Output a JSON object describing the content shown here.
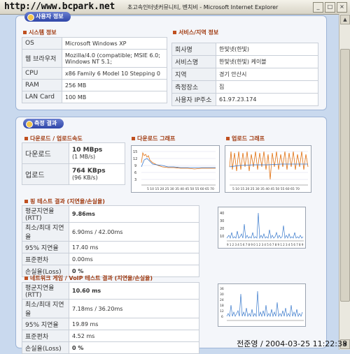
{
  "browser": {
    "address_overlay": "http://www.bcpark.net",
    "title": "초고속인터넷커뮤니티, 벤치비 - Microsoft Internet Explorer"
  },
  "system_panel": {
    "header": "사용자 정보",
    "system_section": "시스템 정보",
    "system_rows": [
      {
        "k": "OS",
        "v": "Microsoft Windows XP"
      },
      {
        "k": "웹 브라우저",
        "v": "Mozilla/4.0 (compatible; MSIE 6.0; Windows NT 5.1;"
      },
      {
        "k": "CPU",
        "v": "x86 Family 6 Model 10 Stepping 0"
      },
      {
        "k": "RAM",
        "v": "256 MB"
      },
      {
        "k": "LAN Card",
        "v": "100 MB"
      }
    ],
    "service_section": "서비스/지역 정보",
    "service_rows": [
      {
        "k": "회사명",
        "v": "한빛넷(한빛)"
      },
      {
        "k": "서비스명",
        "v": "한빛넷(한빛) 케이블"
      },
      {
        "k": "지역",
        "v": "경기 안산시"
      },
      {
        "k": "측정장소",
        "v": "집"
      },
      {
        "k": "사용자 IP주소",
        "v": "61.97.23.174"
      }
    ]
  },
  "results_panel": {
    "header": "측정 결과",
    "speed_section": "다운로드 / 업로드속도",
    "download_label": "다운로드",
    "download_main": "10 MBps",
    "download_sub": "(1 MB/s)",
    "upload_label": "업로드",
    "upload_main": "764 KBps",
    "upload_sub": "(96 KB/s)",
    "dl_graph_title": "다운로드 그래프",
    "ul_graph_title": "업로드 그래프",
    "dl_graph_y": [
      "15",
      "12",
      "9",
      "6",
      "3"
    ],
    "dl_graph_x": [
      "5",
      "10",
      "15",
      "20",
      "25",
      "30",
      "35",
      "40",
      "45",
      "50",
      "55",
      "60",
      "65",
      "70"
    ],
    "ping_section": "핑 테스트 결과 (지연율/손실율)",
    "ping_rows": [
      {
        "k": "평균지연율(RTT)",
        "v": "9.86ms",
        "bold": true
      },
      {
        "k": "최소/최대 지연율",
        "v": "6.90ms / 42.00ms"
      },
      {
        "k": "95% 지연율",
        "v": "17.40 ms"
      },
      {
        "k": "표준편차",
        "v": "0.00ms"
      },
      {
        "k": "손실율(Loss)",
        "v": "0 %",
        "bold": true
      }
    ],
    "ping_graph_y": [
      "40",
      "30",
      "20",
      "10"
    ],
    "ping_graph_x": "9 1 2 3 4 5 6 7 8 9 0 1 2 3 4 5 6 7 8 9 1 2 3 4 5 6 7 8 9",
    "game_section": "네트워크 게임 / VoIP 테스트 결과 (지연율/손실율)",
    "game_rows": [
      {
        "k": "평균지연율(RTT)",
        "v": "10.60 ms",
        "bold": true
      },
      {
        "k": "최소/최대 지연율",
        "v": "7.18ms / 36.20ms"
      },
      {
        "k": "95% 지연율",
        "v": "19.89 ms"
      },
      {
        "k": "표준편차",
        "v": "4.52 ms"
      },
      {
        "k": "손실율(Loss)",
        "v": "0 %",
        "bold": true
      }
    ],
    "game_graph_y": [
      "36",
      "30",
      "24",
      "18",
      "12",
      "6"
    ]
  },
  "footer": "전준영 / 2004-03-25 11:22:38",
  "colors": {
    "download_line": "#e07010",
    "avg_line": "#3a7acc",
    "panel_border": "#9db4d6",
    "header_pill": "#2f45a8"
  }
}
